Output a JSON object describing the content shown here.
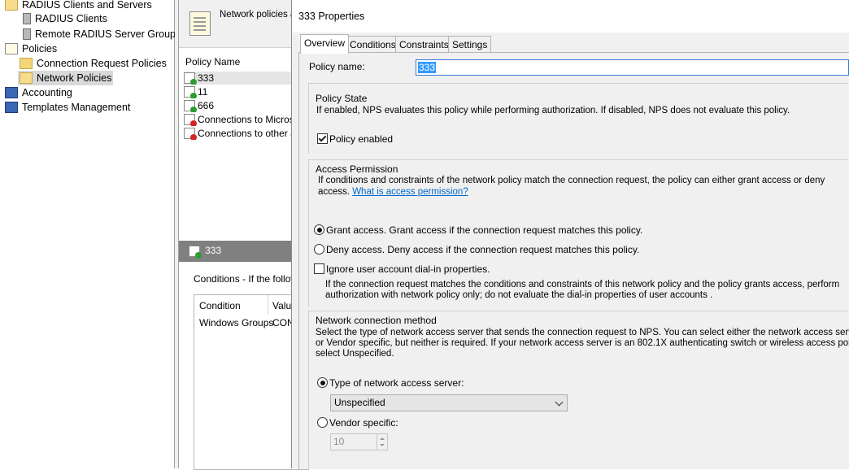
{
  "tree": {
    "radius_clients_and_servers": "RADIUS Clients and Servers",
    "radius_clients": "RADIUS Clients",
    "remote_radius_server_groups": "Remote RADIUS Server Groups",
    "policies": "Policies",
    "connection_request_policies": "Connection Request Policies",
    "network_policies": "Network Policies",
    "accounting": "Accounting",
    "templates_management": "Templates Management"
  },
  "middle": {
    "header_text": "Network policies al",
    "column_policy_name": "Policy Name",
    "policies": [
      {
        "name": "333",
        "status": "ok"
      },
      {
        "name": "11",
        "status": "ok"
      },
      {
        "name": "666",
        "status": "ok"
      },
      {
        "name": "Connections to Microsof",
        "status": "deny"
      },
      {
        "name": "Connections to other acc",
        "status": "deny"
      }
    ],
    "selected_name": "333",
    "conditions_label": "Conditions - If the followin",
    "col_condition": "Condition",
    "col_value": "Valu",
    "condition_row": {
      "condition": "Windows Groups",
      "value": "CON"
    }
  },
  "dialog": {
    "title": "333 Properties",
    "tabs": [
      "Overview",
      "Conditions",
      "Constraints",
      "Settings"
    ],
    "policy_name_label": "Policy name:",
    "policy_name_value": "333",
    "policy_state": {
      "title": "Policy State",
      "desc": "If enabled, NPS evaluates this policy while performing authorization. If disabled, NPS does not evaluate this policy.",
      "enabled_label": "Policy enabled",
      "enabled": true
    },
    "access_permission": {
      "title": "Access Permission",
      "desc_line1": "If conditions and constraints of the network policy match the connection request, the policy can either grant access or deny",
      "desc_line2": "access.",
      "link": "What is access permission?",
      "grant_label": "Grant access. Grant access if the connection request matches this policy.",
      "deny_label": "Deny access. Deny access if the connection request matches this policy.",
      "ignore_label": "Ignore user account dial-in properties.",
      "ignore_desc_line1": "If the connection request matches the conditions and constraints of this network policy and the policy grants access, perform",
      "ignore_desc_line2": "authorization with network policy only; do not evaluate the dial-in properties of user accounts ."
    },
    "network_connection_method": {
      "title": "Network connection method",
      "desc_line1": "Select the type of network access server that sends the connection request to NPS. You can select either the network access server type",
      "desc_line2": "or Vendor specific, but neither is required.  If your network access server is an 802.1X authenticating switch or wireless access point,",
      "desc_line3": "select Unspecified.",
      "type_label": "Type of network access server:",
      "type_value": "Unspecified",
      "vendor_label": "Vendor specific:",
      "vendor_value": "10"
    }
  }
}
